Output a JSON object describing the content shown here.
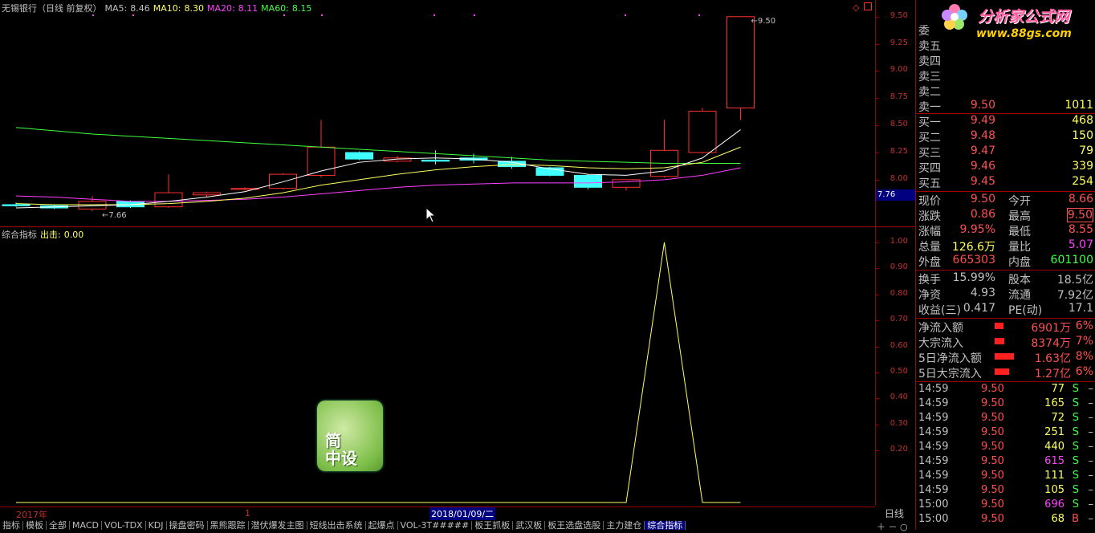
{
  "header": {
    "stock": "无锡银行（日线 前复权）",
    "ma5_label": "MA5:",
    "ma5": "8.46",
    "ma10_label": "MA10:",
    "ma10": "8.30",
    "ma20_label": "MA20:",
    "ma20": "8.11",
    "ma60_label": "MA60:",
    "ma60": "8.15"
  },
  "indicator_header": {
    "name": "综合指标",
    "out_label": "出击:",
    "out_value": "0.00"
  },
  "colors": {
    "ma5": "#ffffff",
    "ma10": "#ffff60",
    "ma20": "#ff40ff",
    "ma60": "#40ff40",
    "up": "#ff3030",
    "down": "#40ffff",
    "axis": "#a00000"
  },
  "price_axis": [
    "9.50",
    "9.25",
    "9.00",
    "8.75",
    "8.50",
    "8.25",
    "8.00"
  ],
  "current_price_tag": "7.76",
  "high_label": "9.50",
  "low_label": "7.66",
  "ind_axis": [
    "1.00",
    "0.90",
    "0.80",
    "0.70",
    "0.60",
    "0.50",
    "0.40",
    "0.30",
    "0.20"
  ],
  "dates": {
    "start": "2017年",
    "marker": "1",
    "cursor": "2018/01/09/二"
  },
  "period": "日线",
  "candles": [
    {
      "o": 7.77,
      "h": 7.79,
      "l": 7.75,
      "c": 7.76
    },
    {
      "o": 7.76,
      "h": 7.77,
      "l": 7.73,
      "c": 7.74
    },
    {
      "o": 7.73,
      "h": 7.85,
      "l": 7.71,
      "c": 7.8
    },
    {
      "o": 7.8,
      "h": 7.81,
      "l": 7.74,
      "c": 7.75
    },
    {
      "o": 7.75,
      "h": 8.05,
      "l": 7.74,
      "c": 7.88
    },
    {
      "o": 7.86,
      "h": 7.89,
      "l": 7.84,
      "c": 7.88
    },
    {
      "o": 7.91,
      "h": 7.93,
      "l": 7.9,
      "c": 7.92
    },
    {
      "o": 7.92,
      "h": 8.06,
      "l": 7.91,
      "c": 8.05
    },
    {
      "o": 8.04,
      "h": 8.55,
      "l": 8.02,
      "c": 8.3
    },
    {
      "o": 8.25,
      "h": 8.26,
      "l": 8.18,
      "c": 8.19
    },
    {
      "o": 8.17,
      "h": 8.22,
      "l": 8.16,
      "c": 8.2
    },
    {
      "o": 8.18,
      "h": 8.27,
      "l": 8.14,
      "c": 8.17
    },
    {
      "o": 8.2,
      "h": 8.24,
      "l": 8.15,
      "c": 8.18
    },
    {
      "o": 8.17,
      "h": 8.21,
      "l": 8.1,
      "c": 8.12
    },
    {
      "o": 8.11,
      "h": 8.12,
      "l": 8.03,
      "c": 8.04
    },
    {
      "o": 8.04,
      "h": 8.05,
      "l": 7.91,
      "c": 7.93
    },
    {
      "o": 7.93,
      "h": 8.0,
      "l": 7.9,
      "c": 8.0
    },
    {
      "o": 8.03,
      "h": 8.55,
      "l": 8.02,
      "c": 8.27
    },
    {
      "o": 8.25,
      "h": 8.66,
      "l": 8.24,
      "c": 8.63
    },
    {
      "o": 8.66,
      "h": 9.5,
      "l": 8.55,
      "c": 9.5
    }
  ],
  "ma5_line": [
    7.74,
    7.75,
    7.76,
    7.77,
    7.8,
    7.84,
    7.89,
    7.98,
    8.08,
    8.16,
    8.19,
    8.2,
    8.19,
    8.16,
    8.1,
    8.05,
    8.04,
    8.08,
    8.2,
    8.46
  ],
  "ma10_line": [
    7.78,
    7.77,
    7.77,
    7.77,
    7.78,
    7.8,
    7.83,
    7.88,
    7.95,
    8.0,
    8.05,
    8.09,
    8.12,
    8.14,
    8.13,
    8.11,
    8.1,
    8.11,
    8.16,
    8.3
  ],
  "ma20_line": [
    7.85,
    7.84,
    7.82,
    7.8,
    7.8,
    7.81,
    7.82,
    7.84,
    7.87,
    7.9,
    7.93,
    7.95,
    7.96,
    7.97,
    7.97,
    7.97,
    7.98,
    8.0,
    8.04,
    8.11
  ],
  "ma60_line": [
    8.48,
    8.45,
    8.42,
    8.4,
    8.38,
    8.36,
    8.34,
    8.32,
    8.3,
    8.28,
    8.26,
    8.24,
    8.22,
    8.2,
    8.18,
    8.17,
    8.16,
    8.15,
    8.15,
    8.15
  ],
  "ind_line": [
    0,
    0,
    0,
    0,
    0,
    0,
    0,
    0,
    0,
    0,
    0,
    0,
    0,
    0,
    0,
    0,
    0,
    1,
    0,
    0
  ],
  "quotes": {
    "sell": [
      {
        "label": "卖五",
        "price": "",
        "vol": ""
      },
      {
        "label": "卖四",
        "price": "",
        "vol": ""
      },
      {
        "label": "卖三",
        "price": "",
        "vol": ""
      },
      {
        "label": "卖二",
        "price": "",
        "vol": ""
      },
      {
        "label": "卖一",
        "price": "9.50",
        "vol": "1011"
      }
    ],
    "sell_top": "委",
    "buy": [
      {
        "label": "买一",
        "price": "9.49",
        "vol": "468"
      },
      {
        "label": "买二",
        "price": "9.48",
        "vol": "150"
      },
      {
        "label": "买三",
        "price": "9.47",
        "vol": "79"
      },
      {
        "label": "买四",
        "price": "9.46",
        "vol": "339"
      },
      {
        "label": "买五",
        "price": "9.45",
        "vol": "254"
      }
    ],
    "stats": [
      {
        "l1": "现价",
        "v1": "9.50",
        "l2": "今开",
        "v2": "8.66"
      },
      {
        "l1": "涨跌",
        "v1": "0.86",
        "l2": "最高",
        "v2": "9.50"
      },
      {
        "l1": "涨幅",
        "v1": "9.95%",
        "l2": "最低",
        "v2": "8.55"
      },
      {
        "l1": "总量",
        "v1": "126.6万",
        "l2": "量比",
        "v2": "5.07"
      },
      {
        "l1": "外盘",
        "v1": "665303",
        "l2": "内盘",
        "v2": "601100"
      }
    ],
    "fund": [
      {
        "l1": "换手",
        "v1": "15.99%",
        "l2": "股本",
        "v2": "18.5亿"
      },
      {
        "l1": "净资",
        "v1": "4.93",
        "l2": "流通",
        "v2": "7.92亿"
      },
      {
        "l1": "收益(三)",
        "v1": "0.417",
        "l2": "PE(动)",
        "v2": "17.1"
      }
    ],
    "flow": [
      {
        "l": "净流入额",
        "v": "6901万",
        "p": "6%",
        "bar": 0.35
      },
      {
        "l": "大宗流入",
        "v": "8374万",
        "p": "7%",
        "bar": 0.4
      },
      {
        "l": "5日净流入额",
        "v": "1.63亿",
        "p": "8%",
        "bar": 0.8
      },
      {
        "l": "5日大宗流入",
        "v": "1.27亿",
        "p": "6%",
        "bar": 0.6
      }
    ],
    "ticks": [
      {
        "t": "14:59",
        "p": "9.50",
        "v": "77",
        "s": "S"
      },
      {
        "t": "14:59",
        "p": "9.50",
        "v": "165",
        "s": "S"
      },
      {
        "t": "14:59",
        "p": "9.50",
        "v": "72",
        "s": "S"
      },
      {
        "t": "14:59",
        "p": "9.50",
        "v": "251",
        "s": "S"
      },
      {
        "t": "14:59",
        "p": "9.50",
        "v": "440",
        "s": "S"
      },
      {
        "t": "14:59",
        "p": "9.50",
        "v": "615",
        "s": "S"
      },
      {
        "t": "14:59",
        "p": "9.50",
        "v": "111",
        "s": "S"
      },
      {
        "t": "14:59",
        "p": "9.50",
        "v": "105",
        "s": "S"
      },
      {
        "t": "15:00",
        "p": "9.50",
        "v": "696",
        "s": "S"
      },
      {
        "t": "15:00",
        "p": "9.50",
        "v": "68",
        "s": "B"
      }
    ]
  },
  "logo": {
    "title": "分析家公式网",
    "url": "www.88gs.com"
  },
  "watermark": {
    "line1": "简",
    "line2": "中设"
  },
  "tabs": [
    "指标",
    "模板",
    "全部",
    "MACD",
    "VOL-TDX",
    "KDJ",
    "操盘密码",
    "黑熊跟踪",
    "潜伏爆发主图",
    "短线出击系统",
    "起爆点",
    "VOL-3T#####",
    "板王抓板",
    "武汉板",
    "板王选盘选股",
    "主力建仓",
    "综合指标"
  ],
  "active_tab": 16
}
